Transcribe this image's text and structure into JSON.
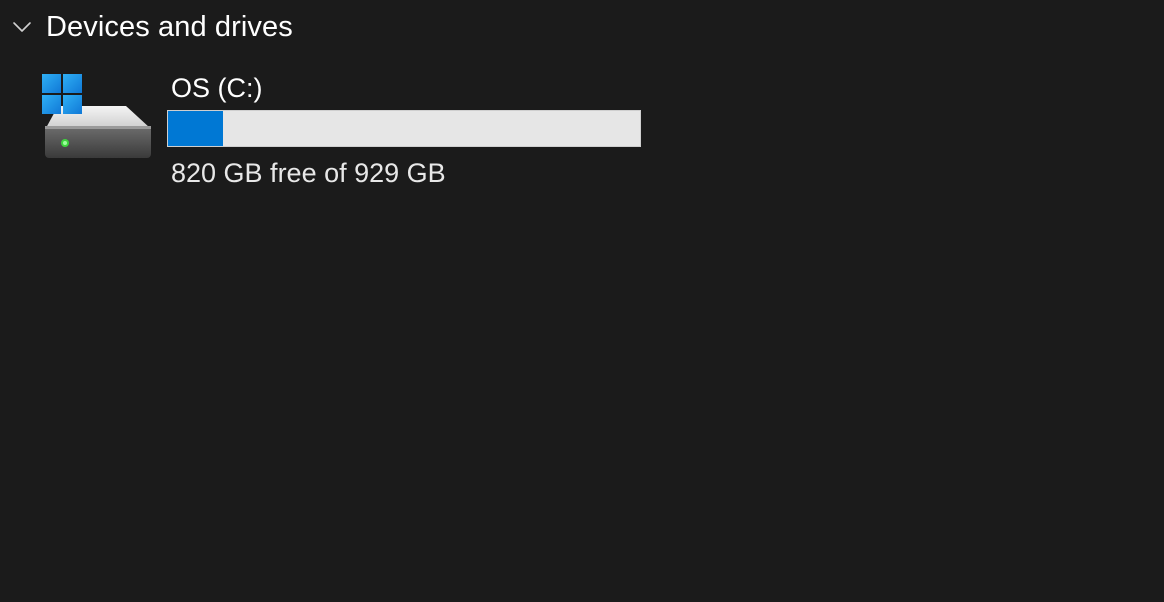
{
  "group": {
    "title": "Devices and drives",
    "expanded": true,
    "chevron_icon": "chevron-down-icon"
  },
  "drives": [
    {
      "name": "OS (C:)",
      "free_text": "820 GB free of 929 GB",
      "used_fraction": 0.117,
      "icon": "hard-drive-windows-icon"
    }
  ],
  "colors": {
    "background": "#1b1b1b",
    "bar_fill": "#0078d4",
    "bar_track": "#e6e6e6",
    "windows_logo": "#1e9be8"
  }
}
